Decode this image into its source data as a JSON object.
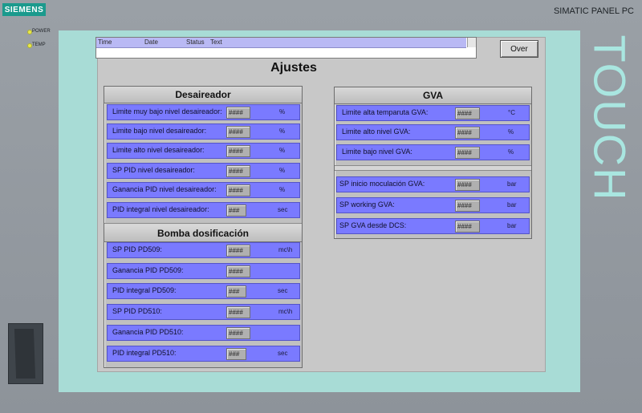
{
  "bezel": {
    "logo": "SIEMENS",
    "brand": "SIMATIC PANEL PC",
    "leds": [
      {
        "label": "POWER"
      },
      {
        "label": "TEMP"
      }
    ],
    "touch": "TOUCH",
    "led_color": "#e9e94b"
  },
  "alarm_view": {
    "columns": [
      "Time",
      "Date",
      "Status",
      "Text"
    ]
  },
  "over_button": "Over",
  "title": "Ajustes",
  "colors": {
    "row_fill": "#7a7aff",
    "screen": "#a8dcd6",
    "logo": "#1b9a8d"
  },
  "desaireador": {
    "header": "Desaireador",
    "rows": [
      {
        "label": "Limite muy bajo nivel desaireador:",
        "value": "####",
        "unit": "%"
      },
      {
        "label": "Limite bajo nivel desaireador:",
        "value": "####",
        "unit": "%"
      },
      {
        "label": "Limite alto nivel desaireador:",
        "value": "####",
        "unit": "%"
      },
      {
        "label": "SP PID nivel desaireador:",
        "value": "####",
        "unit": "%"
      },
      {
        "label": "Ganancia PID nivel desaireador:",
        "value": "####",
        "unit": "%"
      },
      {
        "label": "PID integral nivel desaireador:",
        "value": "###",
        "unit": "sec"
      }
    ]
  },
  "bomba": {
    "header": "Bomba dosificación",
    "rows": [
      {
        "label": "SP PID PD509:",
        "value": "####",
        "unit": "mc\\h"
      },
      {
        "label": "Ganancia PID PD509:",
        "value": "####",
        "unit": ""
      },
      {
        "label": "PID integral PD509:",
        "value": "###",
        "unit": "sec"
      },
      {
        "label": "SP PID PD510:",
        "value": "####",
        "unit": "mc\\h"
      },
      {
        "label": "Ganancia PID PD510:",
        "value": "####",
        "unit": ""
      },
      {
        "label": "PID integral PD510:",
        "value": "###",
        "unit": "sec"
      }
    ]
  },
  "gva": {
    "header": "GVA",
    "rows_top": [
      {
        "label": "Limite alta temparuta GVA:",
        "value": "####",
        "unit": "°C"
      },
      {
        "label": "Limite alto nivel GVA:",
        "value": "####",
        "unit": "%"
      },
      {
        "label": "Limite bajo nivel GVA:",
        "value": "####",
        "unit": "%"
      }
    ],
    "rows_bottom": [
      {
        "label": "SP inicio moculación GVA:",
        "value": "####",
        "unit": "bar"
      },
      {
        "label": "SP working GVA:",
        "value": "####",
        "unit": "bar"
      },
      {
        "label": "SP GVA desde DCS:",
        "value": "####",
        "unit": "bar"
      }
    ]
  }
}
